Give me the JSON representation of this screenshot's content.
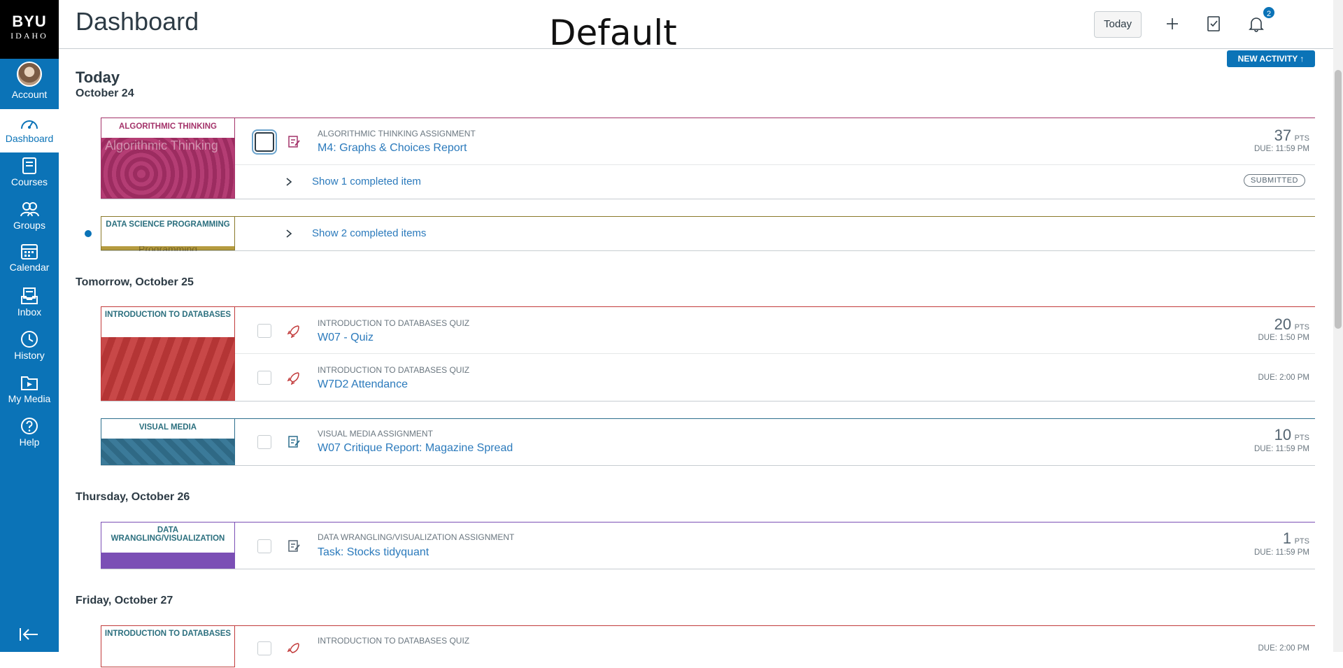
{
  "app": {
    "logo_line1": "BYU",
    "logo_line2": "IDAHO",
    "watermark": "Default"
  },
  "sidebar": {
    "items": [
      {
        "label": "Account",
        "icon": "avatar"
      },
      {
        "label": "Dashboard",
        "icon": "dashboard-icon",
        "active": true
      },
      {
        "label": "Courses",
        "icon": "courses-icon"
      },
      {
        "label": "Groups",
        "icon": "groups-icon"
      },
      {
        "label": "Calendar",
        "icon": "calendar-icon"
      },
      {
        "label": "Inbox",
        "icon": "inbox-icon"
      },
      {
        "label": "History",
        "icon": "history-icon"
      },
      {
        "label": "My Media",
        "icon": "my-media-icon"
      },
      {
        "label": "Help",
        "icon": "help-icon"
      }
    ],
    "collapse_icon": "collapse-nav-icon"
  },
  "header": {
    "title": "Dashboard",
    "today_label": "Today",
    "notification_count": "2",
    "new_activity_label": "NEW ACTIVITY ↑"
  },
  "days": [
    {
      "heading": "Today",
      "date": "October 24",
      "groups": [
        {
          "course": "ALGORITHMIC THINKING",
          "image_text": "Algorithmic Thinking",
          "color": "#a4336a",
          "items": [
            {
              "type": "ALGORITHMIC THINKING ASSIGNMENT",
              "title": "M4: Graphs & Choices Report",
              "points": "37",
              "pts_unit": "PTS",
              "due": "DUE: 11:59 PM",
              "icon": "assignment-icon"
            }
          ],
          "completed": {
            "label": "Show 1 completed item",
            "badge": "SUBMITTED"
          }
        },
        {
          "course": "DATA SCIENCE PROGRAMMING",
          "image_text": "Programming",
          "color": "#8a7a2a",
          "items": [],
          "completed": {
            "label": "Show 2 completed items"
          }
        }
      ]
    },
    {
      "heading": "Tomorrow, October 25",
      "groups": [
        {
          "course": "INTRODUCTION TO DATABASES",
          "color": "#c23b3b",
          "items": [
            {
              "type": "INTRODUCTION TO DATABASES QUIZ",
              "title": "W07 - Quiz",
              "points": "20",
              "pts_unit": "PTS",
              "due": "DUE: 1:50 PM",
              "icon": "quiz-icon"
            },
            {
              "type": "INTRODUCTION TO DATABASES QUIZ",
              "title": "W7D2 Attendance",
              "due": "DUE: 2:00 PM",
              "icon": "quiz-icon"
            }
          ]
        },
        {
          "course": "VISUAL MEDIA",
          "color": "#2d6f8e",
          "items": [
            {
              "type": "VISUAL MEDIA ASSIGNMENT",
              "title": "W07 Critique Report: Magazine Spread",
              "points": "10",
              "pts_unit": "PTS",
              "due": "DUE: 11:59 PM",
              "icon": "assignment-icon"
            }
          ]
        }
      ]
    },
    {
      "heading": "Thursday, October 26",
      "groups": [
        {
          "course": "DATA WRANGLING/VISUALIZATION",
          "color": "#7b4fb5",
          "items": [
            {
              "type": "DATA WRANGLING/VISUALIZATION ASSIGNMENT",
              "title": "Task: Stocks tidyquant",
              "points": "1",
              "pts_unit": "PTS",
              "due": "DUE: 11:59 PM",
              "icon": "assignment-icon"
            }
          ]
        }
      ]
    },
    {
      "heading": "Friday, October 27",
      "groups": [
        {
          "course": "INTRODUCTION TO DATABASES",
          "color": "#c23b3b",
          "items": [
            {
              "type": "INTRODUCTION TO DATABASES QUIZ",
              "title": "",
              "due": "DUE: 2:00 PM",
              "icon": "quiz-icon"
            }
          ]
        }
      ]
    }
  ]
}
